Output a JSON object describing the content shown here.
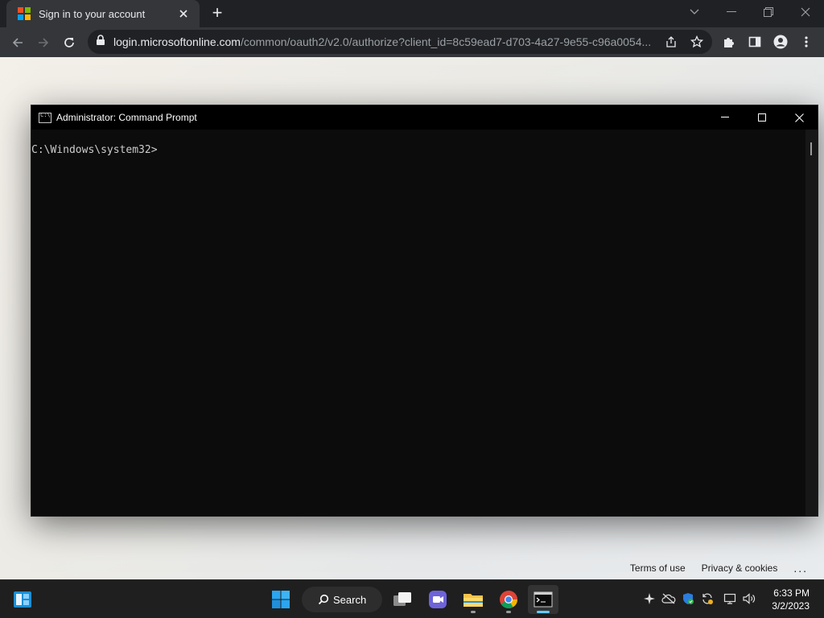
{
  "browser": {
    "tab": {
      "title": "Sign in to your account",
      "close_icon": "close-icon"
    },
    "new_tab_label": "+",
    "address": {
      "host": "login.microsoftonline.com",
      "path": "/common/oauth2/v2.0/authorize?client_id=8c59ead7-d703-4a27-9e55-c96a0054..."
    }
  },
  "page": {
    "footer": {
      "terms": "Terms of use",
      "privacy": "Privacy & cookies",
      "more": "..."
    }
  },
  "cmd": {
    "title": "Administrator:  Command Prompt",
    "prompt": "C:\\Windows\\system32>"
  },
  "taskbar": {
    "search_label": "Search",
    "clock": {
      "time": "6:33 PM",
      "date": "3/2/2023"
    }
  }
}
